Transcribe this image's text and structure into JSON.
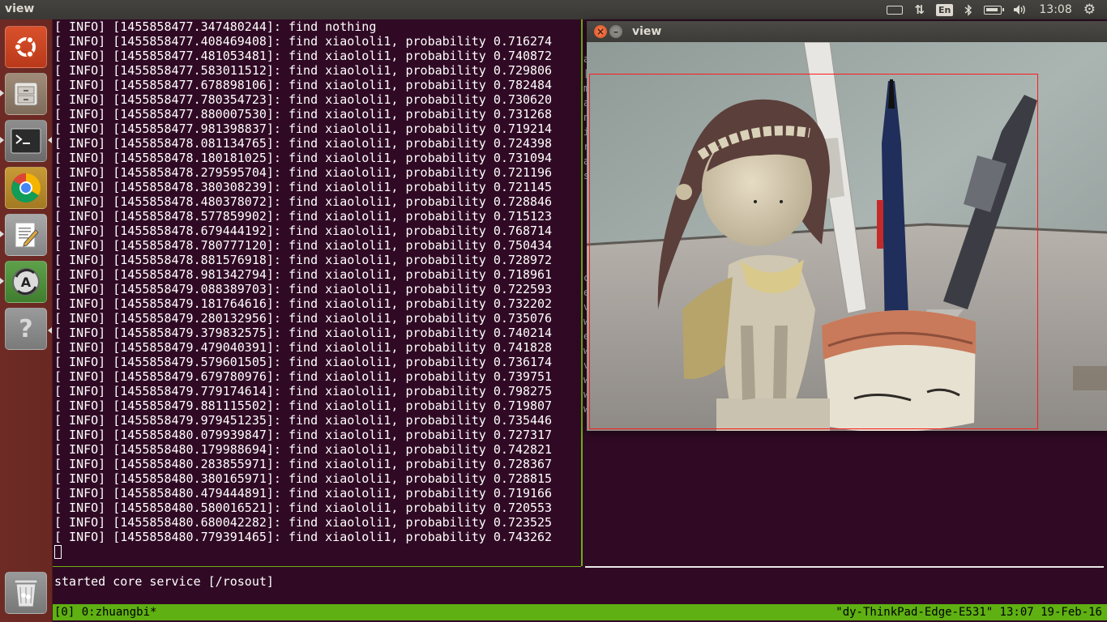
{
  "panel": {
    "title": "view",
    "input_language": "En",
    "clock": "13:08",
    "tray_icons": [
      "keyboard-icon",
      "network-arrows-icon",
      "language-indicator",
      "bluetooth-icon",
      "battery-icon",
      "volume-icon",
      "settings-gear-icon"
    ]
  },
  "launcher": {
    "items": [
      {
        "name": "dash-home",
        "icon": "ubuntu-logo-icon",
        "active": false
      },
      {
        "name": "files",
        "icon": "file-cabinet-icon",
        "active": false
      },
      {
        "name": "terminal",
        "icon": "terminal-icon",
        "active": true
      },
      {
        "name": "chrome",
        "icon": "chrome-icon",
        "active": false
      },
      {
        "name": "text-editor",
        "icon": "text-editor-icon",
        "active": false
      },
      {
        "name": "software-updater",
        "icon": "software-updater-icon",
        "active": false
      },
      {
        "name": "unknown-app",
        "icon": "question-mark-icon",
        "active": false
      },
      {
        "name": "trash",
        "icon": "trash-icon",
        "active": false
      }
    ],
    "unknown_glyph": "?",
    "updater_glyph": "A"
  },
  "terminal": {
    "log_lines": [
      "[ INFO] [1455858477.347480244]: find nothing",
      "[ INFO] [1455858477.408469408]: find xiaololi1, probability 0.716274",
      "[ INFO] [1455858477.481053481]: find xiaololi1, probability 0.740872",
      "[ INFO] [1455858477.583011512]: find xiaololi1, probability 0.729806",
      "[ INFO] [1455858477.678898106]: find xiaololi1, probability 0.782484",
      "[ INFO] [1455858477.780354723]: find xiaololi1, probability 0.730620",
      "[ INFO] [1455858477.880007530]: find xiaololi1, probability 0.731268",
      "[ INFO] [1455858477.981398837]: find xiaololi1, probability 0.719214",
      "[ INFO] [1455858478.081134765]: find xiaololi1, probability 0.724398",
      "[ INFO] [1455858478.180181025]: find xiaololi1, probability 0.731094",
      "[ INFO] [1455858478.279595704]: find xiaololi1, probability 0.721196",
      "[ INFO] [1455858478.380308239]: find xiaololi1, probability 0.721145",
      "[ INFO] [1455858478.480378072]: find xiaololi1, probability 0.728846",
      "[ INFO] [1455858478.577859902]: find xiaololi1, probability 0.715123",
      "[ INFO] [1455858478.679444192]: find xiaololi1, probability 0.768714",
      "[ INFO] [1455858478.780777120]: find xiaololi1, probability 0.750434",
      "[ INFO] [1455858478.881576918]: find xiaololi1, probability 0.728972",
      "[ INFO] [1455858478.981342794]: find xiaololi1, probability 0.718961",
      "[ INFO] [1455858479.088389703]: find xiaololi1, probability 0.722593",
      "[ INFO] [1455858479.181764616]: find xiaololi1, probability 0.732202",
      "[ INFO] [1455858479.280132956]: find xiaololi1, probability 0.735076",
      "[ INFO] [1455858479.379832575]: find xiaololi1, probability 0.740214",
      "[ INFO] [1455858479.479040391]: find xiaololi1, probability 0.741828",
      "[ INFO] [1455858479.579601505]: find xiaololi1, probability 0.736174",
      "[ INFO] [1455858479.679780976]: find xiaololi1, probability 0.739751",
      "[ INFO] [1455858479.779174614]: find xiaololi1, probability 0.798275",
      "[ INFO] [1455858479.881115502]: find xiaololi1, probability 0.719807",
      "[ INFO] [1455858479.979451235]: find xiaololi1, probability 0.735446",
      "[ INFO] [1455858480.079939847]: find xiaololi1, probability 0.727317",
      "[ INFO] [1455858480.179988694]: find xiaololi1, probability 0.742821",
      "[ INFO] [1455858480.283855971]: find xiaololi1, probability 0.728367",
      "[ INFO] [1455858480.380165971]: find xiaololi1, probability 0.728815",
      "[ INFO] [1455858480.479444891]: find xiaololi1, probability 0.719166",
      "[ INFO] [1455858480.580016521]: find xiaololi1, probability 0.720553",
      "[ INFO] [1455858480.680042282]: find xiaololi1, probability 0.723525",
      "[ INFO] [1455858480.779391465]: find xiaololi1, probability 0.743262"
    ],
    "bottom_pane_text": "started core service [/rosout]",
    "right_pane_peek_chars": [
      "a",
      "[",
      "m",
      "a",
      "n",
      "i",
      "r",
      "a",
      "s",
      "",
      "",
      "",
      "",
      "",
      "",
      "c",
      "e",
      "v",
      "w",
      "e",
      "w",
      "v",
      "w",
      "w",
      "w",
      "",
      "",
      "",
      ""
    ],
    "status_left": "[0] 0:zhuangbi*",
    "status_right": "\"dy-ThinkPad-Edge-E531\" 13:07 19-Feb-16",
    "colors": {
      "background": "#300a24",
      "status_bar": "#5fb012",
      "pane_border": "#6cb010"
    }
  },
  "viewer": {
    "title": "view",
    "detection_box_color": "#ff1a1a"
  }
}
